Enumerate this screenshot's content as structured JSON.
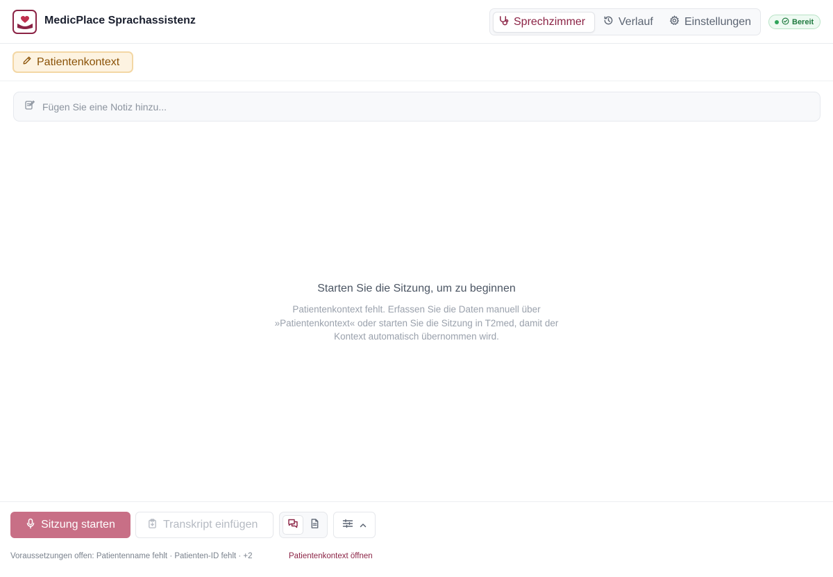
{
  "header": {
    "app_title": "MedicPlace Sprachassistenz",
    "logo_icon": "heart-hands-icon",
    "nav": [
      {
        "label": "Sprechzimmer",
        "icon": "stethoscope-icon",
        "active": true
      },
      {
        "label": "Verlauf",
        "icon": "history-icon",
        "active": false
      },
      {
        "label": "Einstellungen",
        "icon": "gear-icon",
        "active": false
      }
    ],
    "status": {
      "label": "Bereit",
      "color": "#1f7a3f"
    }
  },
  "context": {
    "button_label": "Patientenkontext",
    "icon": "pencil-icon"
  },
  "note": {
    "placeholder": "Fügen Sie eine Notiz hinzu..."
  },
  "empty_state": {
    "title": "Starten Sie die Sitzung, um zu beginnen",
    "description": "Patientenkontext fehlt. Erfassen Sie die Daten manuell über »Patientenkontext« oder starten Sie die Sitzung in T2med, damit der Kontext automatisch übernommen wird."
  },
  "bottom": {
    "start_label": "Sitzung starten",
    "transcript_label": "Transkript einfügen",
    "prerequisites": "Voraussetzungen offen: Patientenname fehlt · Patienten-ID fehlt · +2",
    "open_context_link": "Patientenkontext öffnen"
  },
  "colors": {
    "brand": "#8b2345",
    "start_button": "#c86f86",
    "context_bg": "#fdf3e1"
  }
}
